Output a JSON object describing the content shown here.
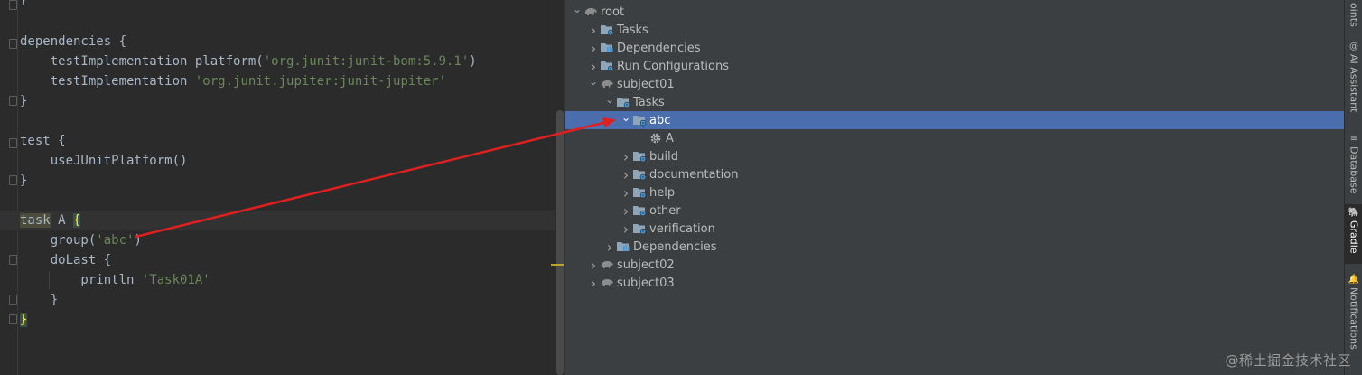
{
  "editor": {
    "top_brace": "}",
    "code_lines": [
      {
        "parts": [
          {
            "t": "dependencies {",
            "c": ""
          }
        ]
      },
      {
        "parts": [
          {
            "t": "    testImplementation platform(",
            "c": ""
          },
          {
            "t": "'org.junit:junit-bom:5.9.1'",
            "c": "str"
          },
          {
            "t": ")",
            "c": ""
          }
        ]
      },
      {
        "parts": [
          {
            "t": "    testImplementation ",
            "c": ""
          },
          {
            "t": "'org.junit.jupiter:junit-jupiter'",
            "c": "str"
          }
        ]
      },
      {
        "parts": [
          {
            "t": "}",
            "c": ""
          }
        ]
      },
      {
        "parts": [
          {
            "t": "",
            "c": ""
          }
        ]
      },
      {
        "parts": [
          {
            "t": "test {",
            "c": ""
          }
        ]
      },
      {
        "parts": [
          {
            "t": "    useJUnitPlatform()",
            "c": ""
          }
        ]
      },
      {
        "parts": [
          {
            "t": "}",
            "c": ""
          }
        ]
      },
      {
        "parts": [
          {
            "t": "",
            "c": ""
          }
        ]
      },
      {
        "parts": [
          {
            "t": "task",
            "c": "kw-hl"
          },
          {
            "t": " A ",
            "c": ""
          },
          {
            "t": "{",
            "c": "brace-hl"
          }
        ],
        "current": true
      },
      {
        "parts": [
          {
            "t": "    group(",
            "c": ""
          },
          {
            "t": "'abc'",
            "c": "str"
          },
          {
            "t": ")",
            "c": ""
          }
        ]
      },
      {
        "parts": [
          {
            "t": "    doLast {",
            "c": ""
          }
        ]
      },
      {
        "parts": [
          {
            "t": "        println ",
            "c": ""
          },
          {
            "t": "'Task01A'",
            "c": "str"
          }
        ]
      },
      {
        "parts": [
          {
            "t": "    }",
            "c": ""
          }
        ]
      },
      {
        "parts": [
          {
            "t": "}",
            "c": "brace-hl"
          }
        ]
      }
    ]
  },
  "gradle_tree": [
    {
      "label": "root",
      "depth": 0,
      "expander": "down",
      "icon": "elephant-icon"
    },
    {
      "label": "Tasks",
      "depth": 1,
      "expander": "right",
      "icon": "task-folder-icon"
    },
    {
      "label": "Dependencies",
      "depth": 1,
      "expander": "right",
      "icon": "dependencies-icon"
    },
    {
      "label": "Run Configurations",
      "depth": 1,
      "expander": "right",
      "icon": "task-folder-icon"
    },
    {
      "label": "subject01",
      "depth": 1,
      "expander": "down",
      "icon": "elephant-icon"
    },
    {
      "label": "Tasks",
      "depth": 2,
      "expander": "down",
      "icon": "task-folder-icon"
    },
    {
      "label": "abc",
      "depth": 3,
      "expander": "down",
      "icon": "task-folder-icon",
      "selected": true
    },
    {
      "label": "A",
      "depth": 4,
      "expander": "none",
      "icon": "gear-icon"
    },
    {
      "label": "build",
      "depth": 3,
      "expander": "right",
      "icon": "task-folder-icon"
    },
    {
      "label": "documentation",
      "depth": 3,
      "expander": "right",
      "icon": "task-folder-icon"
    },
    {
      "label": "help",
      "depth": 3,
      "expander": "right",
      "icon": "task-folder-icon"
    },
    {
      "label": "other",
      "depth": 3,
      "expander": "right",
      "icon": "task-folder-icon"
    },
    {
      "label": "verification",
      "depth": 3,
      "expander": "right",
      "icon": "task-folder-icon"
    },
    {
      "label": "Dependencies",
      "depth": 2,
      "expander": "right",
      "icon": "dependencies-icon"
    },
    {
      "label": "subject02",
      "depth": 1,
      "expander": "right",
      "icon": "elephant-icon"
    },
    {
      "label": "subject03",
      "depth": 1,
      "expander": "right",
      "icon": "elephant-icon"
    }
  ],
  "right_strip": {
    "items": [
      {
        "label": "oints",
        "icon": ""
      },
      {
        "label": "AI Assistant",
        "icon": "@"
      },
      {
        "label": "Database",
        "icon": "≡"
      },
      {
        "label": "Gradle",
        "icon": "🐘",
        "active": true
      },
      {
        "label": "Notifications",
        "icon": "🔔"
      }
    ]
  },
  "watermark": "@稀土掘金技术社区",
  "colors": {
    "selection": "#4b6eaf",
    "string": "#6a8759",
    "arrow": "#e02020"
  }
}
